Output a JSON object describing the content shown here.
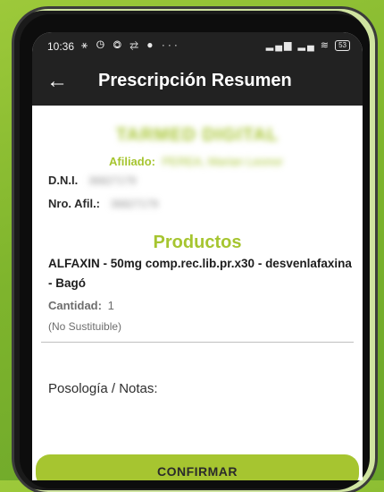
{
  "status_bar": {
    "time": "10:36",
    "notification_icons": "⚹ ◷ ◎ ⇄ ● ···",
    "system_icons": "▂▄▆ ▂▄ ≋",
    "battery": "53"
  },
  "app_bar": {
    "back_icon": "arrow-left-icon",
    "title": "Prescripción Resumen"
  },
  "header": {
    "company": "TARMED DIGITAL",
    "affiliate_label": "Afiliado:",
    "affiliate_value": "PEREA, Marian Leonor"
  },
  "patient": {
    "dni_label": "D.N.I.",
    "dni_value": "36827179",
    "afil_label": "Nro. Afil.:",
    "afil_value": "36827179"
  },
  "products": {
    "title": "Productos",
    "item_name": "ALFAXIN - 50mg comp.rec.lib.pr.x30 - desvenlafaxina - Bagó",
    "quantity_label": "Cantidad:",
    "quantity_value": "1",
    "substitution": "(No Sustituible)"
  },
  "notes": {
    "label": "Posología / Notas:"
  },
  "actions": {
    "confirm_label": "CONFIRMAR"
  },
  "colors": {
    "accent": "#a6c530",
    "app_bar": "#222222",
    "background": "#7fb52d"
  }
}
